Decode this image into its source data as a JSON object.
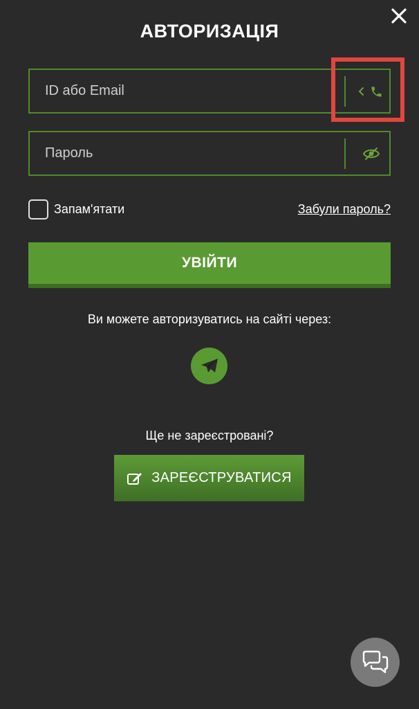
{
  "header": {
    "title": "АВТОРИЗАЦІЯ",
    "close_icon": "close-icon"
  },
  "form": {
    "login": {
      "placeholder": "ID або Email",
      "value": "",
      "toggle_icons": [
        "chevron-left-icon",
        "phone-icon"
      ]
    },
    "password": {
      "placeholder": "Пароль",
      "value": "",
      "toggle_icon": "eye-icon"
    },
    "remember_label": "Запам'ятати",
    "remember_checked": false,
    "forgot_label": "Забули пароль?",
    "submit_label": "УВІЙТИ"
  },
  "social": {
    "text": "Ви можете авторизуватись на сайті через:",
    "icon": "telegram-icon"
  },
  "register": {
    "question": "Ще не зареєстровані?",
    "button_label": "ЗАРЕЄСТРУВАТИСЯ",
    "button_icon": "edit-icon"
  },
  "chat": {
    "icon": "chat-icon"
  },
  "colors": {
    "background": "#2a2a2a",
    "accent": "#5a9a33",
    "highlight": "#e2463d"
  }
}
